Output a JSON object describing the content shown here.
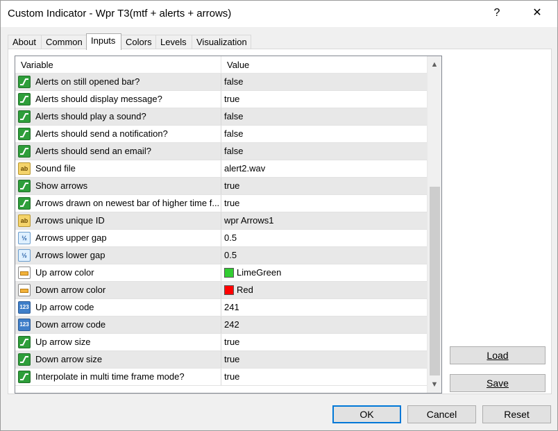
{
  "window": {
    "title": "Custom Indicator - Wpr T3(mtf + alerts + arrows)",
    "help_label": "?",
    "close_label": "✕"
  },
  "tabs": [
    "About",
    "Common",
    "Inputs",
    "Colors",
    "Levels",
    "Visualization"
  ],
  "active_tab": "Inputs",
  "grid": {
    "headers": {
      "variable": "Variable",
      "value": "Value"
    },
    "rows": [
      {
        "variable": "Alerts on still opened bar?",
        "value": "false",
        "type": "bool"
      },
      {
        "variable": "Alerts should display message?",
        "value": "true",
        "type": "bool"
      },
      {
        "variable": "Alerts should play a sound?",
        "value": "false",
        "type": "bool"
      },
      {
        "variable": "Alerts should send a notification?",
        "value": "false",
        "type": "bool"
      },
      {
        "variable": "Alerts should send an email?",
        "value": "false",
        "type": "bool"
      },
      {
        "variable": "Sound file",
        "value": "alert2.wav",
        "type": "string"
      },
      {
        "variable": "Show arrows",
        "value": "true",
        "type": "bool"
      },
      {
        "variable": "Arrows drawn on newest bar of higher time f...",
        "value": "true",
        "type": "bool"
      },
      {
        "variable": "Arrows unique ID",
        "value": "wpr Arrows1",
        "type": "string"
      },
      {
        "variable": "Arrows upper gap",
        "value": "0.5",
        "type": "double"
      },
      {
        "variable": "Arrows lower gap",
        "value": "0.5",
        "type": "double"
      },
      {
        "variable": "Up arrow color",
        "value": "LimeGreen",
        "type": "color",
        "swatch": "#32cd32"
      },
      {
        "variable": "Down arrow color",
        "value": "Red",
        "type": "color",
        "swatch": "#ff0000"
      },
      {
        "variable": "Up arrow code",
        "value": "241",
        "type": "int"
      },
      {
        "variable": "Down arrow code",
        "value": "242",
        "type": "int"
      },
      {
        "variable": "Up arrow size",
        "value": "true",
        "type": "bool"
      },
      {
        "variable": "Down arrow size",
        "value": "true",
        "type": "bool"
      },
      {
        "variable": "Interpolate in multi time frame mode?",
        "value": "true",
        "type": "bool"
      }
    ]
  },
  "icons": {
    "bool": "bool-icon",
    "string": "string-icon",
    "double": "double-icon",
    "int": "int-icon",
    "color": "color-icon"
  },
  "icon_text": {
    "string": "ab",
    "double": "½",
    "int": "123"
  },
  "scroll": {
    "up": "▲",
    "down": "▼"
  },
  "buttons": {
    "load": "Load",
    "save": "Save",
    "ok": "OK",
    "cancel": "Cancel",
    "reset": "Reset"
  }
}
